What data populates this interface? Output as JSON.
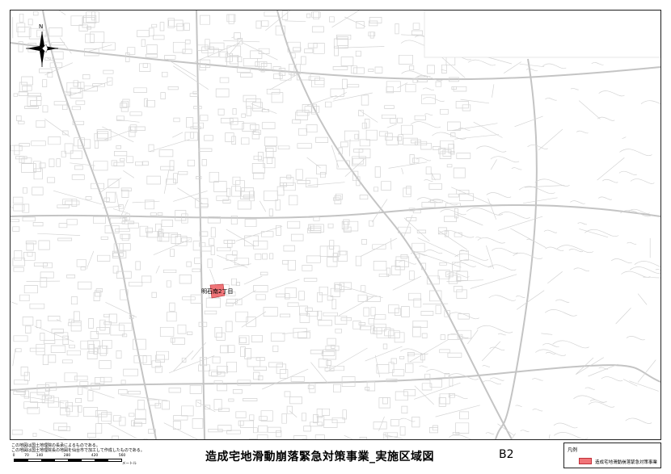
{
  "map": {
    "north_label": "N",
    "site_label": "明石南2丁目",
    "site_color": "#f07478"
  },
  "footer": {
    "note_line1": "この地図は国土地理院の長承によるものである。",
    "note_line2": "この地図は国土地理院長の地図を仙台市で加工して作成したものである。",
    "scale_ticks": [
      "0",
      "70",
      "140",
      "280",
      "420",
      "560"
    ],
    "scale_unit": "メートル",
    "title": "造成宅地滑動崩落緊急対策事業_実施区域図",
    "sheet_id": "B2"
  },
  "legend": {
    "title": "凡例",
    "item_label": "造成宅地滑動崩落緊急対策事業",
    "item_color": "#f07478"
  }
}
